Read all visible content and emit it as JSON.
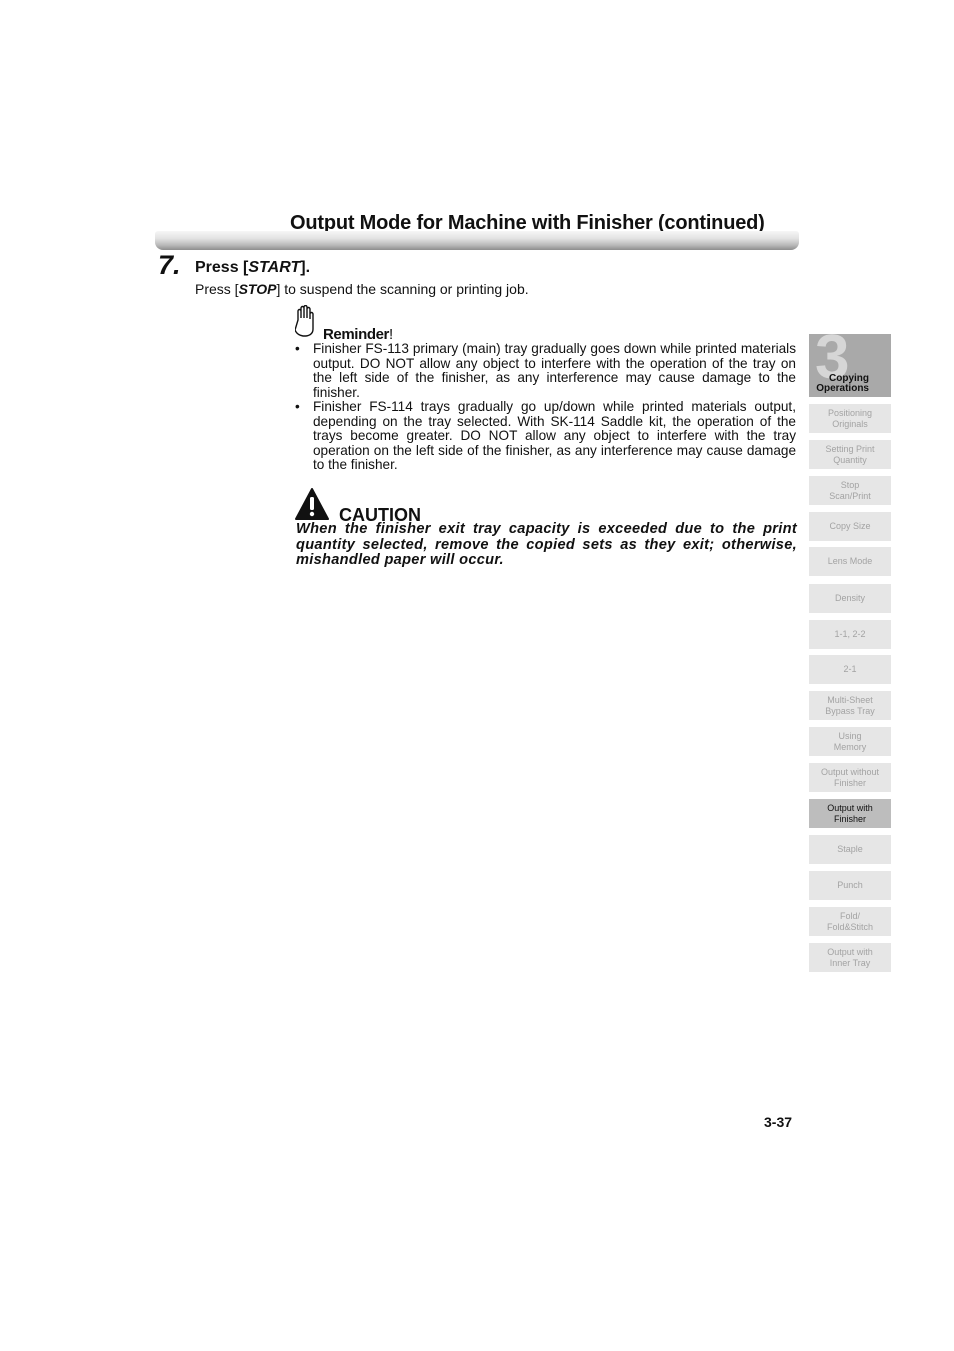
{
  "header": {
    "title": "Output Mode for Machine with Finisher (continued)"
  },
  "step": {
    "number": "7.",
    "head_prefix": "Press [",
    "head_key": "START",
    "head_suffix": "].",
    "sub_prefix": "Press [",
    "sub_key": "STOP",
    "sub_suffix": "] to suspend the scanning or printing job."
  },
  "reminder": {
    "icon": "hand-icon",
    "label": "Reminder",
    "bang": "!",
    "bullet_glyph": "•",
    "items": [
      "Finisher FS-113 primary (main) tray gradually goes down while printed materials output. DO NOT allow any object to interfere with the operation of the tray on the left side of the finisher, as any interference may cause damage to the finisher.",
      "Finisher FS-114 trays gradually go up/down while printed materials output, depending on the tray selected. With SK-114 Saddle kit, the operation of the trays become greater. DO NOT allow any object to interfere with the tray operation on the left side of the finisher, as any interference may cause damage to the finisher."
    ]
  },
  "caution": {
    "icon": "warning-icon",
    "label": "CAUTION",
    "text": "When the finisher exit tray capacity is exceeded due to the print quantity selected, remove the copied sets as they exit; otherwise, mishandled paper will occur."
  },
  "sidebar": {
    "chapter_number": "3",
    "chapter_label_line1": "Copying",
    "chapter_label_line2": "Operations",
    "tabs": [
      {
        "line1": "Positioning",
        "line2": "Originals",
        "active": false
      },
      {
        "line1": "Setting Print",
        "line2": "Quantity",
        "active": false
      },
      {
        "line1": "Stop",
        "line2": "Scan/Print",
        "active": false
      },
      {
        "line1": "Copy Size",
        "line2": "",
        "active": false
      },
      {
        "line1": "Lens Mode",
        "line2": "",
        "active": false
      },
      {
        "line1": "Density",
        "line2": "",
        "active": false
      },
      {
        "line1": "1-1, 2-2",
        "line2": "",
        "active": false
      },
      {
        "line1": "2-1",
        "line2": "",
        "active": false
      },
      {
        "line1": "Multi-Sheet",
        "line2": "Bypass Tray",
        "active": false
      },
      {
        "line1": "Using",
        "line2": "Memory",
        "active": false
      },
      {
        "line1": "Output without",
        "line2": "Finisher",
        "active": false
      },
      {
        "line1": "Output with",
        "line2": "Finisher",
        "active": true
      },
      {
        "line1": "Staple",
        "line2": "",
        "active": false
      },
      {
        "line1": "Punch",
        "line2": "",
        "active": false
      },
      {
        "line1": "Fold/",
        "line2": "Fold&Stitch",
        "active": false
      },
      {
        "line1": "Output with",
        "line2": "Inner Tray",
        "active": false
      }
    ]
  },
  "footer": {
    "page_number": "3-37"
  }
}
